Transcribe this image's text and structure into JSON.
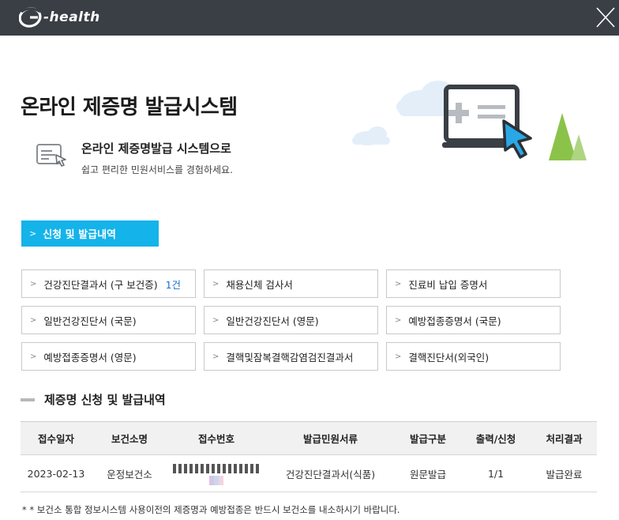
{
  "window": {
    "logo_text": "-health",
    "close_label": "닫기"
  },
  "hero": {
    "title": "온라인 제증명 발급시스템"
  },
  "intro": {
    "title": "온라인 제증명발급 시스템으로",
    "subtitle": "쉽고 편리한 민원서비스를 경험하세요."
  },
  "tabs": {
    "active_label": "신청 및 발급내역"
  },
  "certificates": [
    {
      "label": "건강진단결과서 (구 보건증)",
      "count": "1건"
    },
    {
      "label": "채용신체 검사서",
      "count": ""
    },
    {
      "label": "진료비 납입 증명서",
      "count": ""
    },
    {
      "label": "일반건강진단서 (국문)",
      "count": ""
    },
    {
      "label": "일반건강진단서 (영문)",
      "count": ""
    },
    {
      "label": "예방접종증명서 (국문)",
      "count": ""
    },
    {
      "label": "예방접종증명서 (영문)",
      "count": ""
    },
    {
      "label": "결핵및잠복결핵감염검진결과서",
      "count": ""
    },
    {
      "label": "결핵진단서(외국인)",
      "count": ""
    }
  ],
  "history": {
    "section_title": "제증명 신청 및 발급내역",
    "columns": [
      "접수일자",
      "보건소명",
      "접수번호",
      "발급민원서류",
      "발급구분",
      "출력/신청",
      "처리결과"
    ],
    "rows": [
      {
        "date": "2023-02-13",
        "center": "운정보건소",
        "receipt_no": "",
        "document": "건강진단결과서(식품)",
        "type": "원문발급",
        "print_apply": "1/1",
        "result": "발급완료"
      }
    ]
  },
  "footnote": "* * 보건소 통합 정보시스템 사용이전의 제증명과 예방접종은 반드시 보건소를 내소하시기 바랍니다.",
  "colors": {
    "topbar": "#3a3f45",
    "accent": "#14b3ea",
    "count": "#1a6fd0"
  }
}
